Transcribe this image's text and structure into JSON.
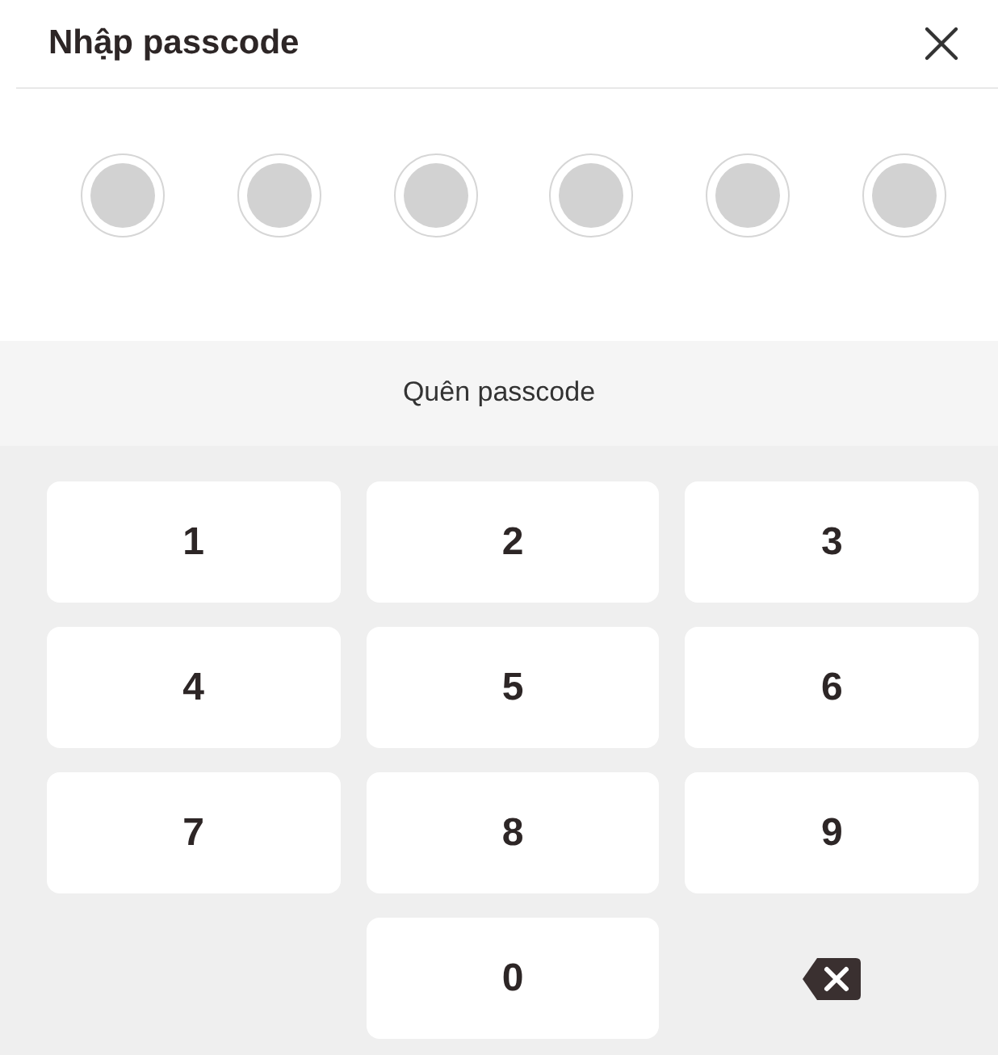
{
  "header": {
    "title": "Nhập passcode"
  },
  "dots": [
    {
      "filled": false
    },
    {
      "filled": false
    },
    {
      "filled": false
    },
    {
      "filled": false
    },
    {
      "filled": false
    },
    {
      "filled": false
    }
  ],
  "forgot_link": "Quên passcode",
  "keys": [
    {
      "kind": "digit",
      "label": "1"
    },
    {
      "kind": "digit",
      "label": "2"
    },
    {
      "kind": "digit",
      "label": "3"
    },
    {
      "kind": "digit",
      "label": "4"
    },
    {
      "kind": "digit",
      "label": "5"
    },
    {
      "kind": "digit",
      "label": "6"
    },
    {
      "kind": "digit",
      "label": "7"
    },
    {
      "kind": "digit",
      "label": "8"
    },
    {
      "kind": "digit",
      "label": "9"
    },
    {
      "kind": "blank"
    },
    {
      "kind": "digit",
      "label": "0"
    },
    {
      "kind": "backspace"
    }
  ]
}
